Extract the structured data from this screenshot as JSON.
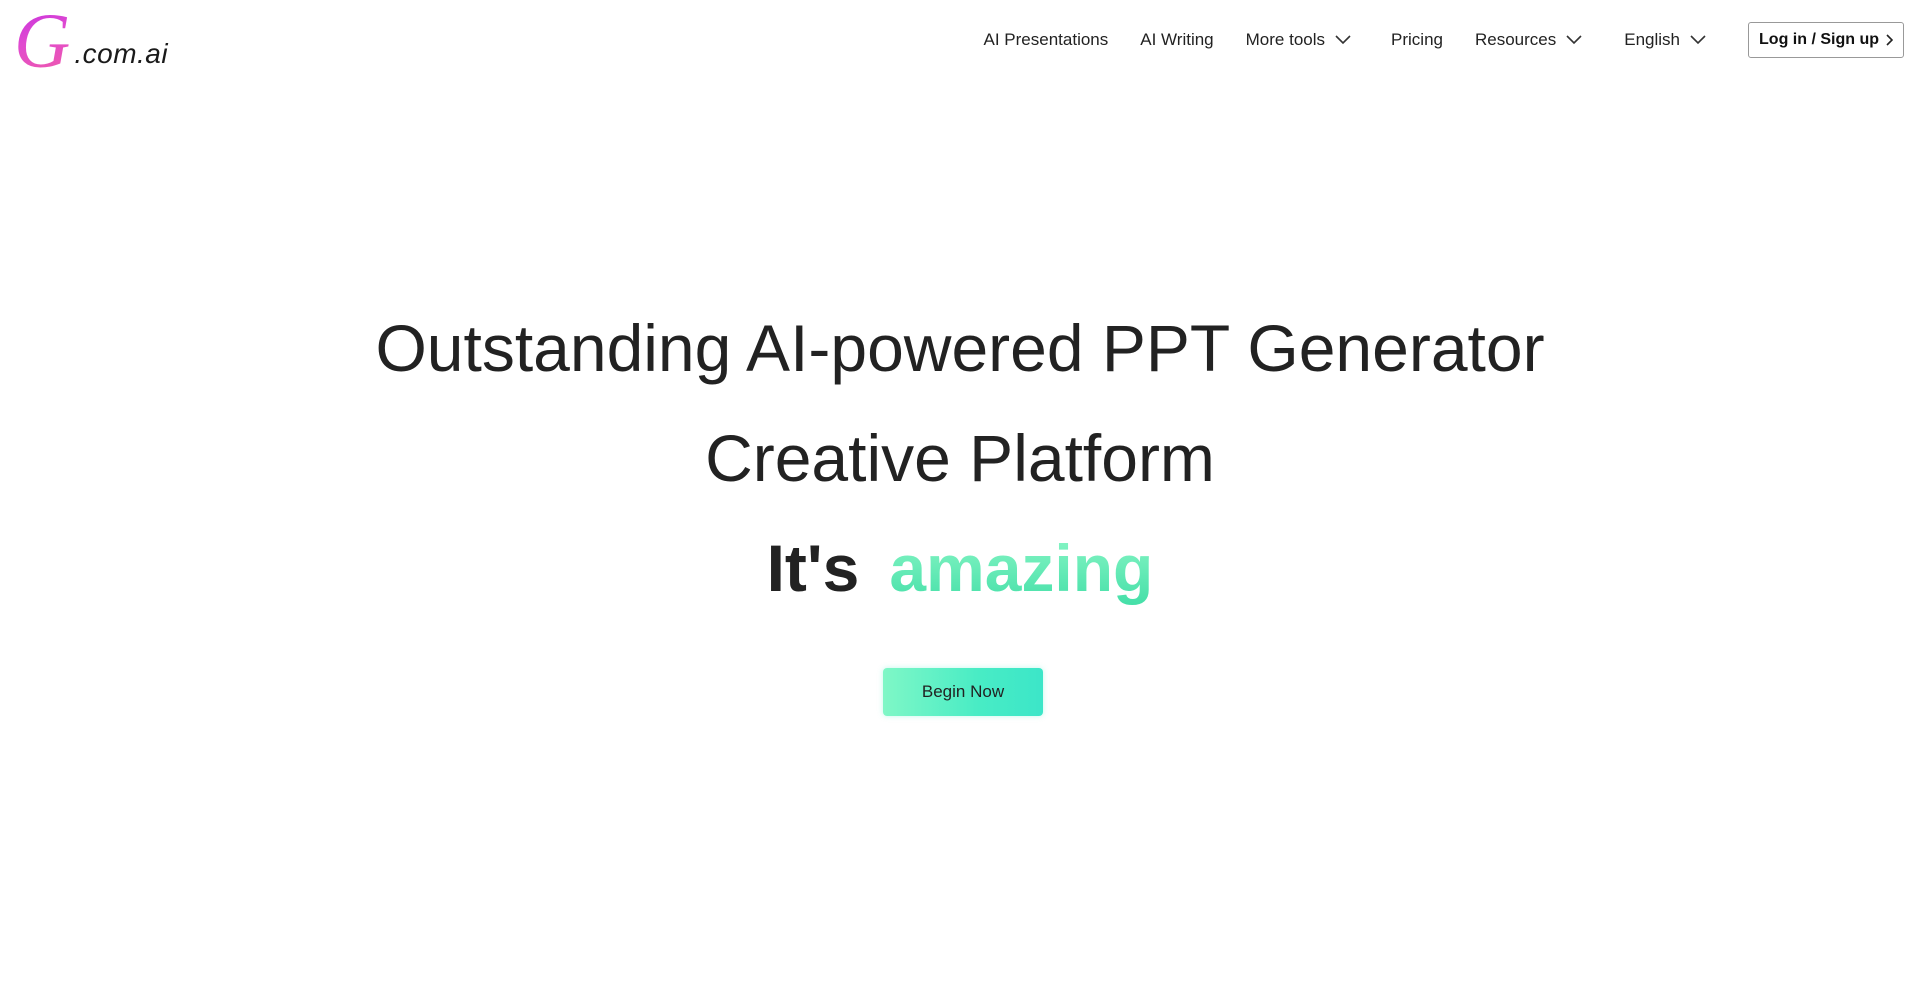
{
  "brand": {
    "logo_letter": "G",
    "logo_suffix": ".com.ai",
    "logo_gradient_start": "#c42ee0",
    "logo_gradient_end": "#f05aa8"
  },
  "nav": {
    "items": [
      {
        "label": "AI Presentations",
        "has_dropdown": false
      },
      {
        "label": "AI Writing",
        "has_dropdown": false
      },
      {
        "label": "More tools",
        "has_dropdown": true,
        "icon": "chevron-down-icon"
      },
      {
        "label": "Pricing",
        "has_dropdown": false
      },
      {
        "label": "Resources",
        "has_dropdown": true,
        "icon": "chevron-down-icon"
      }
    ],
    "language": {
      "label": "English",
      "icon": "chevron-down-icon"
    },
    "login": {
      "label": "Log in / Sign up",
      "icon": "chevron-right-icon"
    }
  },
  "hero": {
    "headline_line1": "Outstanding AI-powered PPT Generator",
    "headline_line2": "Creative Platform",
    "tagline_static": "It's",
    "tagline_accent": "amazing",
    "accent_color": "#5fe9b6",
    "cta_label": "Begin Now",
    "cta_color": "#48ecc5"
  }
}
